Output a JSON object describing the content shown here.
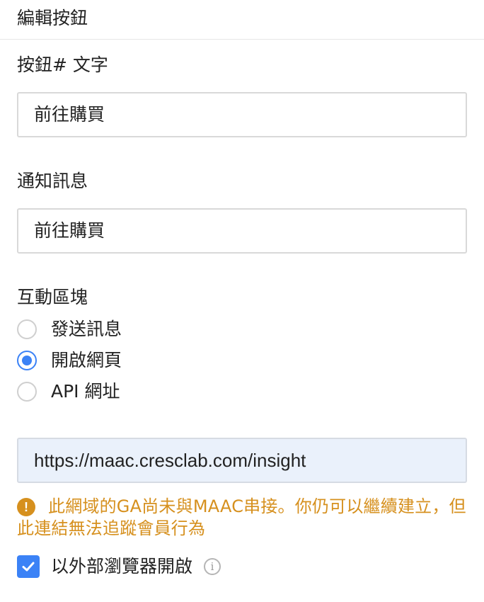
{
  "header": {
    "title": "編輯按鈕"
  },
  "button_text": {
    "label": "按鈕# 文字",
    "value": "前往購買"
  },
  "notification": {
    "label": "通知訊息",
    "value": "前往購買"
  },
  "interaction": {
    "label": "互動區塊",
    "options": [
      {
        "label": "發送訊息",
        "selected": false
      },
      {
        "label": "開啟網頁",
        "selected": true
      },
      {
        "label": "API 網址",
        "selected": false
      }
    ]
  },
  "url": {
    "value": "https://maac.cresclab.com/insight"
  },
  "warning": {
    "icon": "exclamation-circle-icon",
    "text": "此網域的GA尚未與MAAC串接。你仍可以繼續建立，但此連結無法追蹤會員行為"
  },
  "external_browser": {
    "label": "以外部瀏覽器開啟",
    "checked": true,
    "info_icon": "info-icon"
  },
  "colors": {
    "accent": "#3b82f6",
    "warning": "#d6901e",
    "url_field_bg": "#eaf1fb"
  }
}
